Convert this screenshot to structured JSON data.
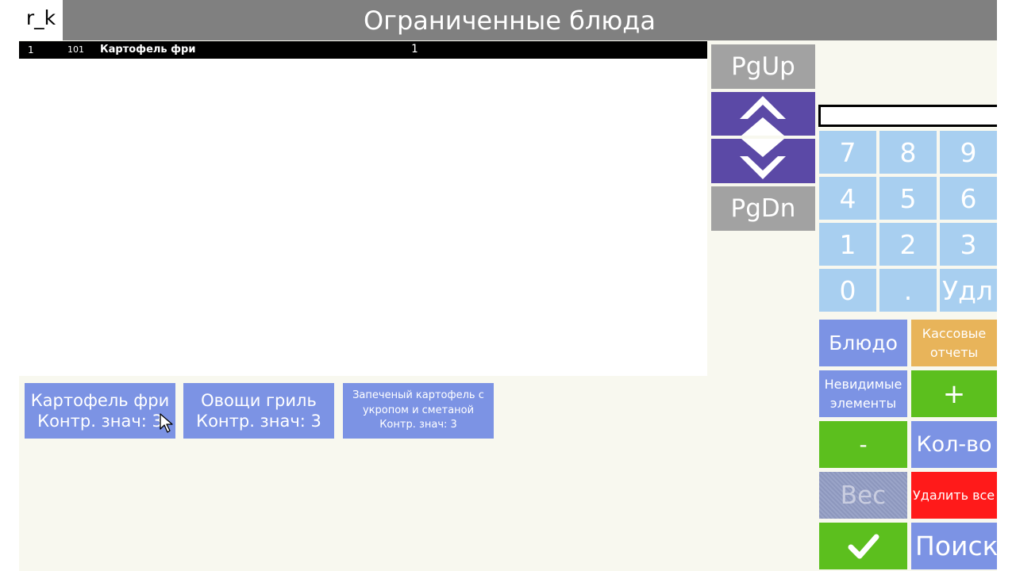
{
  "header": {
    "logo": "r_k",
    "title": "Ограниченные блюда"
  },
  "order_list": {
    "rows": [
      {
        "index": "1",
        "code": "101",
        "name": "Картофель фри",
        "qty": "1"
      }
    ]
  },
  "paging": {
    "page_up": "PgUp",
    "page_down": "PgDn"
  },
  "keypad": {
    "keys": [
      "7",
      "8",
      "9",
      "4",
      "5",
      "6",
      "1",
      "2",
      "3",
      "0",
      ".",
      "Удл"
    ]
  },
  "functions": {
    "dish": "Блюдо",
    "cash_reports": "Кассовые отчеты",
    "invisible_items": "Невидимые элементы",
    "plus": "+",
    "minus": "-",
    "quantity": "Кол-во",
    "weight": "Вес",
    "delete_all": "Удалить все",
    "search": "Поиск"
  },
  "dishes": [
    {
      "name": "Картофель фри",
      "control": "Контр. знач: 3"
    },
    {
      "name": "Овощи гриль",
      "control": "Контр. знач: 3"
    },
    {
      "name": "Запеченый картофель с укропом и сметаной",
      "control": "Контр. знач: 3"
    }
  ],
  "colors": {
    "header_bg": "#808080",
    "selected_row_bg": "#000000",
    "keypad_bg": "#a8cff0",
    "button_blue": "#7c93e4",
    "button_orange": "#e8b45a",
    "button_green": "#5cbf1e",
    "button_red": "#ff1a1a",
    "arrow_purple": "#5b49a6",
    "page_gray": "#a2a2a2"
  },
  "icons": {
    "up": "chevron-up-icon",
    "down": "chevron-down-icon",
    "confirm": "checkmark-icon",
    "cursor": "mouse-pointer-icon"
  }
}
